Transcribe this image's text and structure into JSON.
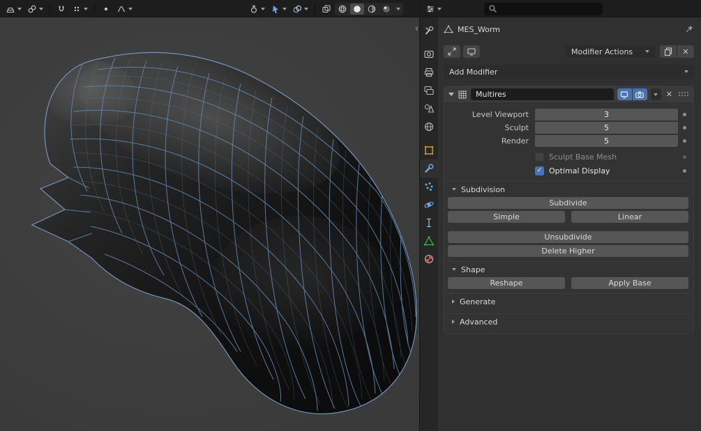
{
  "colors": {
    "accent": "#4772b3",
    "object_orange": "#e8933a",
    "modifier_blue": "#6fa8dc",
    "data_green": "#3fb950",
    "material_red": "#c05555"
  },
  "viewport": {
    "collapse_arrow": "‹"
  },
  "search": {
    "placeholder": ""
  },
  "glyphs": {
    "close": "✕",
    "check": "✓"
  },
  "panel": {
    "object_name": "MES_Worm",
    "modifier_actions_label": "Modifier Actions",
    "add_modifier_label": "Add Modifier",
    "modifier": {
      "name": "Multires",
      "fields": [
        {
          "label": "Level Viewport",
          "value": "3"
        },
        {
          "label": "Sculpt",
          "value": "5"
        },
        {
          "label": "Render",
          "value": "5"
        }
      ],
      "checkboxes": [
        {
          "label": "Sculpt Base Mesh",
          "checked": false
        },
        {
          "label": "Optimal Display",
          "checked": true
        }
      ],
      "sections": {
        "subdivision": {
          "title": "Subdivision",
          "subdivide": "Subdivide",
          "simple": "Simple",
          "linear": "Linear",
          "unsubdivide": "Unsubdivide",
          "delete_higher": "Delete Higher"
        },
        "shape": {
          "title": "Shape",
          "reshape": "Reshape",
          "apply_base": "Apply Base"
        },
        "generate": {
          "title": "Generate"
        },
        "advanced": {
          "title": "Advanced"
        }
      }
    }
  }
}
